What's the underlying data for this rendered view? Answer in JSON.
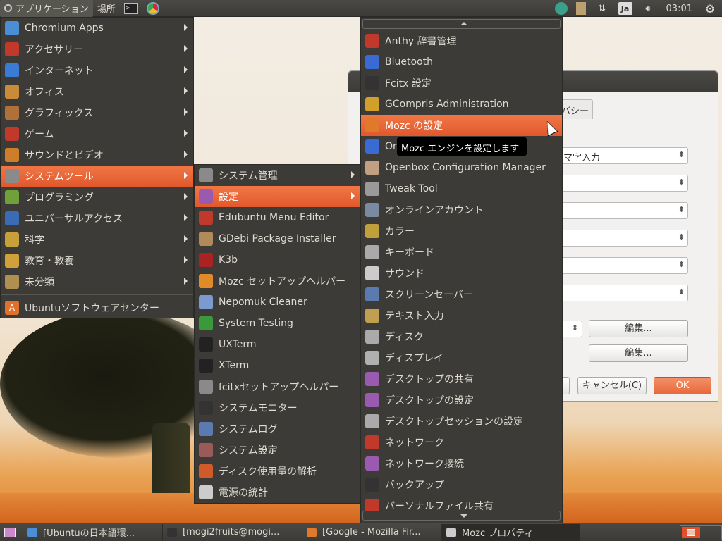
{
  "top_panel": {
    "apps_menu": "アプリケーション",
    "places_menu": "場所",
    "terminal_glyph": ">_",
    "input_method": "Ja",
    "clock": "03:01"
  },
  "menu_applications": {
    "items": [
      {
        "label": "Chromium Apps",
        "icon": "chromium-icon",
        "color": "#4a8fd6"
      },
      {
        "label": "アクセサリー",
        "icon": "accessories-icon",
        "color": "#c0392b"
      },
      {
        "label": "インターネット",
        "icon": "globe-icon",
        "color": "#3a7bd5"
      },
      {
        "label": "オフィス",
        "icon": "office-icon",
        "color": "#c78b3a"
      },
      {
        "label": "グラフィックス",
        "icon": "graphics-icon",
        "color": "#b0703a"
      },
      {
        "label": "ゲーム",
        "icon": "cards-icon",
        "color": "#c0392b"
      },
      {
        "label": "サウンドとビデオ",
        "icon": "multimedia-icon",
        "color": "#d07d2a"
      },
      {
        "label": "システムツール",
        "icon": "gear-icon",
        "color": "#8a8a8a"
      },
      {
        "label": "プログラミング",
        "icon": "brush-icon",
        "color": "#6fa03a"
      },
      {
        "label": "ユニバーサルアクセス",
        "icon": "accessibility-icon",
        "color": "#3a6bb5"
      },
      {
        "label": "科学",
        "icon": "science-icon",
        "color": "#c7a03a"
      },
      {
        "label": "教育・教養",
        "icon": "education-icon",
        "color": "#d0a03a"
      },
      {
        "label": "未分類",
        "icon": "misc-icon",
        "color": "#b09050"
      }
    ],
    "software_center": "Ubuntuソフトウェアセンター"
  },
  "menu_system_tools": {
    "items": [
      {
        "label": "システム管理",
        "icon": "admin-gear-icon",
        "color": "#8a8a8a"
      },
      {
        "label": "設定",
        "icon": "settings-icon",
        "color": "#9a5ab0"
      },
      {
        "label": "Edubuntu Menu Editor",
        "icon": "menu-editor-icon",
        "color": "#c0392b"
      },
      {
        "label": "GDebi Package Installer",
        "icon": "package-icon",
        "color": "#b08a5a"
      },
      {
        "label": "K3b",
        "icon": "k3b-icon",
        "color": "#aa2222"
      },
      {
        "label": "Mozc セットアップヘルパー",
        "icon": "gear-orange-icon",
        "color": "#e08a2a"
      },
      {
        "label": "Nepomuk Cleaner",
        "icon": "nepomuk-icon",
        "color": "#7a9ad0"
      },
      {
        "label": "System Testing",
        "icon": "check-icon",
        "color": "#3a9a3a"
      },
      {
        "label": "UXTerm",
        "icon": "xterm-icon",
        "color": "#222222"
      },
      {
        "label": "XTerm",
        "icon": "xterm-icon",
        "color": "#222222"
      },
      {
        "label": "fcitxセットアップヘルパー",
        "icon": "gear-icon",
        "color": "#8a8a8a"
      },
      {
        "label": "システムモニター",
        "icon": "monitor-icon",
        "color": "#333333"
      },
      {
        "label": "システムログ",
        "icon": "log-icon",
        "color": "#5a7ab0"
      },
      {
        "label": "システム設定",
        "icon": "system-settings-icon",
        "color": "#9a5a5a"
      },
      {
        "label": "ディスク使用量の解析",
        "icon": "pie-icon",
        "color": "#d05a2a"
      },
      {
        "label": "電源の統計",
        "icon": "power-stats-icon",
        "color": "#cccccc"
      }
    ]
  },
  "menu_settings": {
    "items": [
      {
        "label": "Anthy 辞書管理",
        "icon": "dictionary-icon",
        "color": "#c0392b"
      },
      {
        "label": "Bluetooth",
        "icon": "bluetooth-icon",
        "color": "#3a6bd5"
      },
      {
        "label": "Fcitx 設定",
        "icon": "penguin-icon",
        "color": "#333333"
      },
      {
        "label": "GCompris Administration",
        "icon": "gcompris-icon",
        "color": "#d0a02a"
      },
      {
        "label": "Mozc の設定",
        "icon": "mozc-icon",
        "color": "#e07a2a"
      },
      {
        "label": "Or",
        "icon": "openbox-icon",
        "color": "#3a6bd5"
      },
      {
        "label": "Openbox Configuration Manager",
        "icon": "openbox-config-icon",
        "color": "#c0a080"
      },
      {
        "label": "Tweak Tool",
        "icon": "tweak-icon",
        "color": "#9a9a9a"
      },
      {
        "label": "オンラインアカウント",
        "icon": "accounts-icon",
        "color": "#7a8aa0"
      },
      {
        "label": "カラー",
        "icon": "color-icon",
        "color": "#c0a03a"
      },
      {
        "label": "キーボード",
        "icon": "keyboard-icon",
        "color": "#aaaaaa"
      },
      {
        "label": "サウンド",
        "icon": "sound-icon",
        "color": "#cccccc"
      },
      {
        "label": "スクリーンセーバー",
        "icon": "screensaver-icon",
        "color": "#5a7ab0"
      },
      {
        "label": "テキスト入力",
        "icon": "text-input-icon",
        "color": "#c0a050"
      },
      {
        "label": "ディスク",
        "icon": "disk-icon",
        "color": "#aaaaaa"
      },
      {
        "label": "ディスプレイ",
        "icon": "display-icon",
        "color": "#b0b0b0"
      },
      {
        "label": "デスクトップの共有",
        "icon": "desktop-share-icon",
        "color": "#9a5ab0"
      },
      {
        "label": "デスクトップの設定",
        "icon": "desktop-settings-icon",
        "color": "#9a5ab0"
      },
      {
        "label": "デスクトップセッションの設定",
        "icon": "session-icon",
        "color": "#aaaaaa"
      },
      {
        "label": "ネットワーク",
        "icon": "network-icon",
        "color": "#c0392b"
      },
      {
        "label": "ネットワーク接続",
        "icon": "network-connections-icon",
        "color": "#9a5ab0"
      },
      {
        "label": "バックアップ",
        "icon": "backup-icon",
        "color": "#333333"
      },
      {
        "label": "パーソナルファイル共有",
        "icon": "file-share-icon",
        "color": "#c0392b"
      }
    ]
  },
  "tooltip": "Mozc エンジンを設定します",
  "dialog": {
    "tab_partial": "バシー",
    "combo_partial": "マ字入力",
    "edit_button_1": "編集...",
    "edit_button_2": "編集...",
    "cancel_button": "キャンセル(C)",
    "ok_button": "OK"
  },
  "taskbar": {
    "tasks": [
      {
        "label": "[Ubuntuの日本語環...",
        "icon": "chromium-icon",
        "color": "#4a8fd6"
      },
      {
        "label": "[mogi2fruits@mogi...",
        "icon": "terminal-icon",
        "color": "#333333"
      },
      {
        "label": "[Google - Mozilla Fir...",
        "icon": "firefox-icon",
        "color": "#e07a2a"
      },
      {
        "label": "Mozc プロパティ",
        "icon": "window-icon",
        "color": "#cccccc"
      }
    ]
  }
}
